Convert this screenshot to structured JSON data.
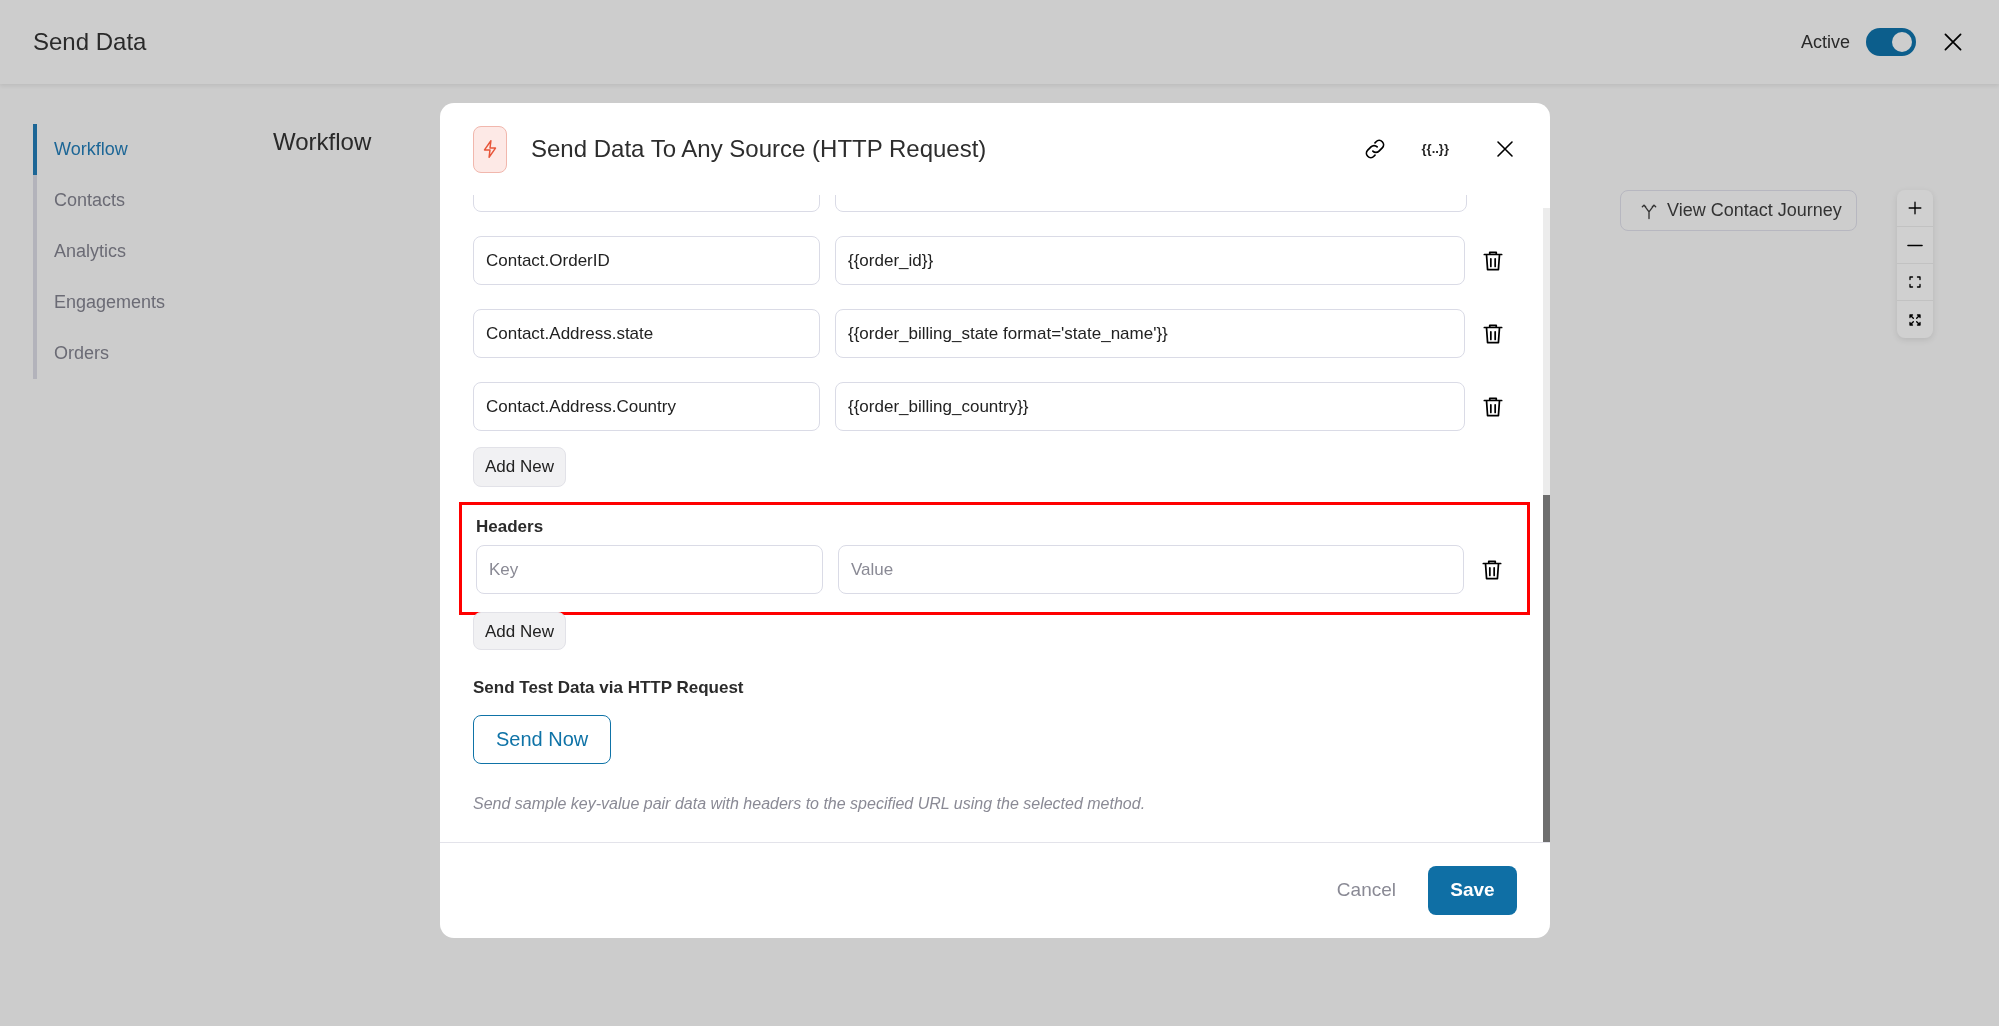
{
  "header": {
    "title": "Send Data",
    "active_label": "Active",
    "active_on": true
  },
  "sidebar": {
    "items": [
      {
        "label": "Workflow",
        "selected": true
      },
      {
        "label": "Contacts",
        "selected": false
      },
      {
        "label": "Analytics",
        "selected": false
      },
      {
        "label": "Engagements",
        "selected": false
      },
      {
        "label": "Orders",
        "selected": false
      }
    ]
  },
  "canvas": {
    "heading": "Workflow",
    "journey_button": "View Contact Journey"
  },
  "modal": {
    "title": "Send Data To Any Source (HTTP Request)",
    "variables_label": "{{..}}",
    "fields": [
      {
        "key": "Contact.OrderID",
        "value": "{{order_id}}"
      },
      {
        "key": "Contact.Address.state",
        "value": "{{order_billing_state format='state_name'}}"
      },
      {
        "key": "Contact.Address.Country",
        "value": "{{order_billing_country}}"
      }
    ],
    "add_new_label": "Add New",
    "headers": {
      "label": "Headers",
      "highlighted": true,
      "rows": [
        {
          "key_placeholder": "Key",
          "value_placeholder": "Value"
        }
      ],
      "add_new_label": "Add New"
    },
    "test": {
      "label": "Send Test Data via HTTP Request",
      "button": "Send Now",
      "help": "Send sample key-value pair data with headers to the specified URL using the selected method."
    },
    "footer": {
      "cancel": "Cancel",
      "save": "Save"
    }
  }
}
